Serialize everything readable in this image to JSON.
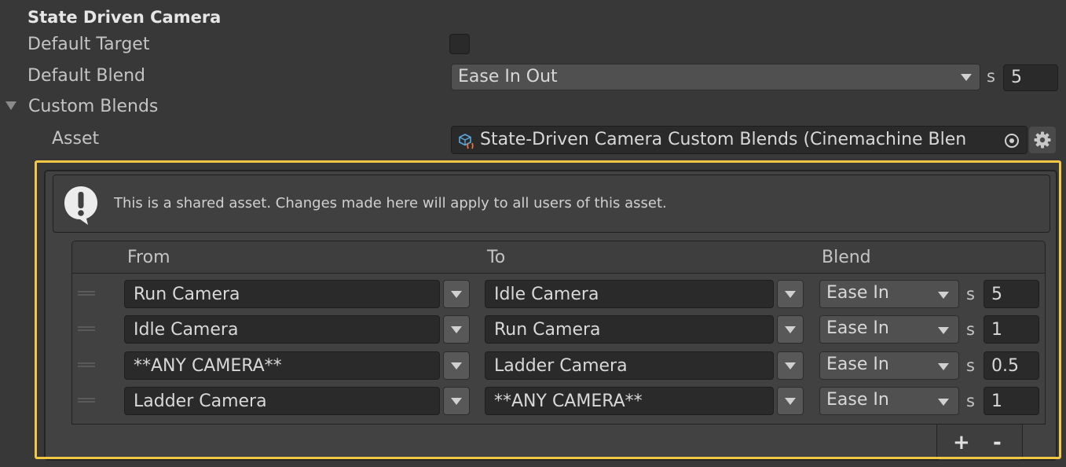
{
  "section_title": "State Driven Camera",
  "default_target": {
    "label": "Default Target",
    "checked": false
  },
  "default_blend": {
    "label": "Default Blend",
    "value": "Ease In Out",
    "unit": "s",
    "duration": "5"
  },
  "custom_blends": {
    "label": "Custom Blends",
    "expanded": true,
    "asset_label": "Asset",
    "asset_value": "State-Driven Camera Custom Blends (Cinemachine Blen",
    "help_message": "This is a shared asset.  Changes made here will apply to all users of this asset.",
    "columns": {
      "from": "From",
      "to": "To",
      "blend": "Blend"
    },
    "rows": [
      {
        "from": "Run Camera",
        "to": "Idle Camera",
        "blend": "Ease In",
        "unit": "s",
        "time": "5"
      },
      {
        "from": "Idle Camera",
        "to": "Run Camera",
        "blend": "Ease In",
        "unit": "s",
        "time": "1"
      },
      {
        "from": "**ANY CAMERA**",
        "to": "Ladder Camera",
        "blend": "Ease In",
        "unit": "s",
        "time": "0.5"
      },
      {
        "from": "Ladder Camera",
        "to": "**ANY CAMERA**",
        "blend": "Ease In",
        "unit": "s",
        "time": "1"
      }
    ],
    "add_label": "+",
    "remove_label": "-"
  },
  "highlight_color": "#f2c744",
  "icons": [
    "foldout-arrow-icon",
    "asset-icon",
    "object-picker-icon",
    "gear-icon",
    "warning-icon",
    "drag-handle-icon",
    "dropdown-arrow-icon"
  ]
}
